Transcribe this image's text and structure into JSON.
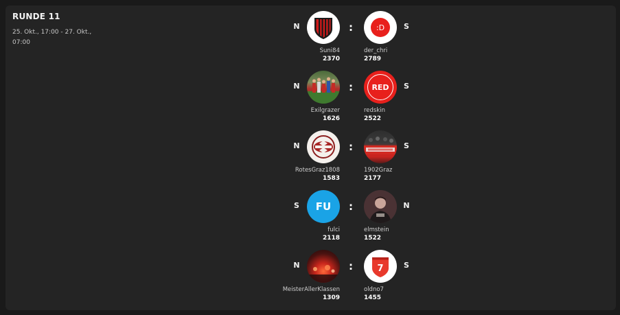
{
  "round": {
    "title": "RUNDE 11",
    "dates": "25. Okt., 17:00 - 27. Okt., 07:00"
  },
  "separator": ":",
  "matches": [
    {
      "home": {
        "result": "N",
        "name": "Suni84",
        "score": "2370",
        "avatar": "striped-shield-icon"
      },
      "away": {
        "result": "S",
        "name": "der_chri",
        "score": "2789",
        "avatar": "smiley-text-badge",
        "avatar_text": ":D"
      }
    },
    {
      "home": {
        "result": "N",
        "name": "Exilgrazer",
        "score": "1626",
        "avatar": "football-team-photo"
      },
      "away": {
        "result": "S",
        "name": "redskin",
        "score": "2522",
        "avatar": "red-text-badge",
        "avatar_text": "RED"
      }
    },
    {
      "home": {
        "result": "N",
        "name": "RotesGraz1808",
        "score": "1583",
        "avatar": "club-crest-emblem"
      },
      "away": {
        "result": "S",
        "name": "1902Graz",
        "score": "2177",
        "avatar": "fan-banner-photo"
      }
    },
    {
      "home": {
        "result": "S",
        "name": "fulci",
        "score": "2118",
        "avatar": "initials-badge",
        "avatar_text": "FU"
      },
      "away": {
        "result": "N",
        "name": "elmstein",
        "score": "1522",
        "avatar": "portrait-photo"
      }
    },
    {
      "home": {
        "result": "N",
        "name": "MeisterAllerKlassen",
        "score": "1309",
        "avatar": "pyro-crowd-photo"
      },
      "away": {
        "result": "S",
        "name": "oldno7",
        "score": "1455",
        "avatar": "number-shield-icon",
        "avatar_text": "7"
      }
    }
  ],
  "colors": {
    "background": "#1a1a1a",
    "card": "#242424",
    "red": "#e8201c",
    "blue": "#1aa3e6"
  }
}
